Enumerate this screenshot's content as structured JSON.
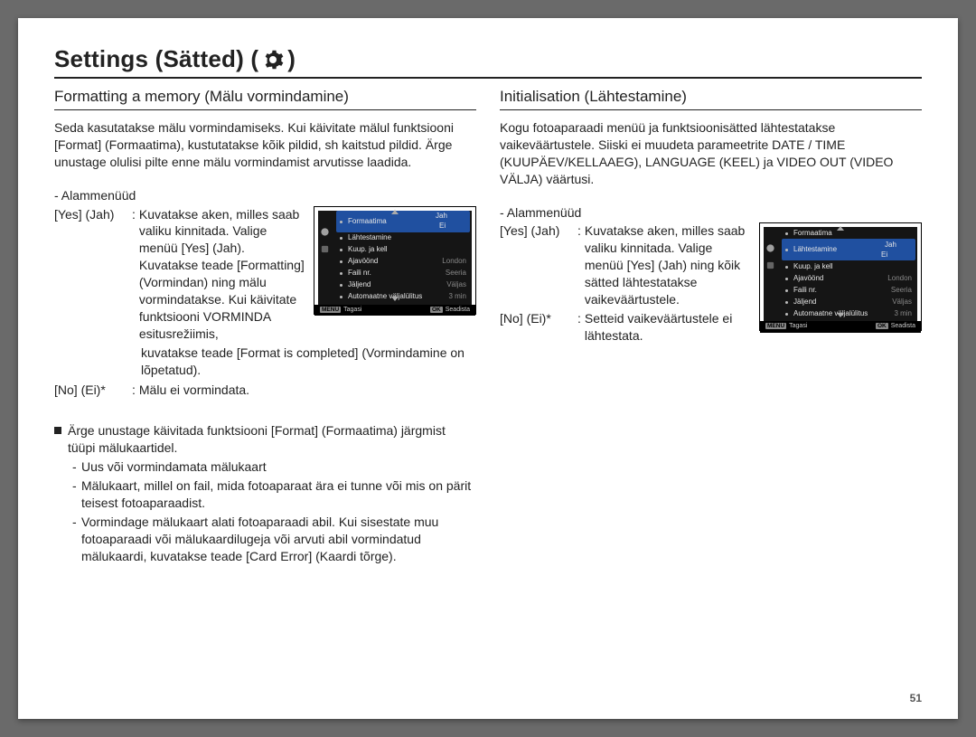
{
  "title_prefix": "Settings (Sätted) (",
  "title_suffix": ")",
  "page_number": "51",
  "left": {
    "heading": "Formatting a memory (Mälu vormindamine)",
    "intro": "Seda kasutatakse mälu vormindamiseks. Kui käivitate mälul funktsiooni [Format] (Formaatima), kustutatakse kõik pildid, sh kaitstud pildid. Ärge unustage olulisi pilte enne mälu vormindamist arvutisse laadida.",
    "submenu_label": "- Alammenüüd",
    "yes_term": "[Yes] (Jah)",
    "yes_desc_1": "Kuvatakse aken, milles saab valiku kinnitada. Valige menüü [Yes] (Jah). Kuvatakse teade [Formatting] (Vormindan) ning mälu vormindatakse. Kui käivitate funktsiooni VORMINDA esitusrežiimis,",
    "yes_desc_2": "kuvatakse teade [Format is completed] (Vormindamine on lõpetatud).",
    "no_term": "[No] (Ei)*",
    "no_desc": "Mälu ei vormindata.",
    "notes_lead": "Ärge unustage käivitada funktsiooni [Format] (Formaatima) järgmist tüüpi mälukaartidel.",
    "note1": "Uus või vormindamata mälukaart",
    "note2": "Mälukaart, millel on fail, mida fotoaparaat ära ei tunne või mis on pärit teisest fotoaparaadist.",
    "note3": "Vormindage mälukaart alati fotoaparaadi abil. Kui sisestate muu fotoaparaadi või mälukaardilugeja või arvuti abil vormindatud mälukaardi, kuvatakse teade [Card Error] (Kaardi tõrge)."
  },
  "right": {
    "heading": "Initialisation (Lähtestamine)",
    "intro": "Kogu fotoaparaadi menüü ja funktsioonisätted lähtestatakse vaikeväärtustele. Siiski ei muudeta parameetrite DATE / TIME (KUUPÄEV/KELLAAEG), LANGUAGE (KEEL) ja VIDEO OUT (VIDEO VÄLJA) väärtusi.",
    "submenu_label": "- Alammenüüd",
    "yes_term": "[Yes] (Jah)",
    "yes_desc": "Kuvatakse aken, milles saab valiku kinnitada. Valige menüü [Yes] (Jah) ning kõik sätted lähtestatakse vaikeväärtustele.",
    "no_term": "[No] (Ei)*",
    "no_desc": "Setteid vaikeväärtustele ei lähtestata."
  },
  "shot_left": {
    "rows": [
      {
        "label": "Formaatima",
        "value": "",
        "hl": true,
        "opts": [
          "Jah",
          "Ei"
        ],
        "opt_sel": 1
      },
      {
        "label": "Lähtestamine",
        "value": ""
      },
      {
        "label": "Kuup. ja kell",
        "value": ""
      },
      {
        "label": "Ajavöönd",
        "value": "London"
      },
      {
        "label": "Faili nr.",
        "value": "Seeria"
      },
      {
        "label": "Jäljend",
        "value": "Väljas"
      },
      {
        "label": "Automaatne väljalülitus",
        "value": "3 min"
      }
    ],
    "footer_left_tag": "MENU",
    "footer_left": "Tagasi",
    "footer_right_tag": "OK",
    "footer_right": "Seadista"
  },
  "shot_right": {
    "rows": [
      {
        "label": "Formaatima",
        "value": ""
      },
      {
        "label": "Lähtestamine",
        "value": "",
        "hl": true,
        "opts": [
          "Jah",
          "Ei"
        ],
        "opt_sel": 0
      },
      {
        "label": "Kuup. ja kell",
        "value": ""
      },
      {
        "label": "Ajavöönd",
        "value": "London"
      },
      {
        "label": "Faili nr.",
        "value": "Seeria"
      },
      {
        "label": "Jäljend",
        "value": "Väljas"
      },
      {
        "label": "Automaatne väljalülitus",
        "value": "3 min"
      }
    ],
    "footer_left_tag": "MENU",
    "footer_left": "Tagasi",
    "footer_right_tag": "OK",
    "footer_right": "Seadista"
  }
}
